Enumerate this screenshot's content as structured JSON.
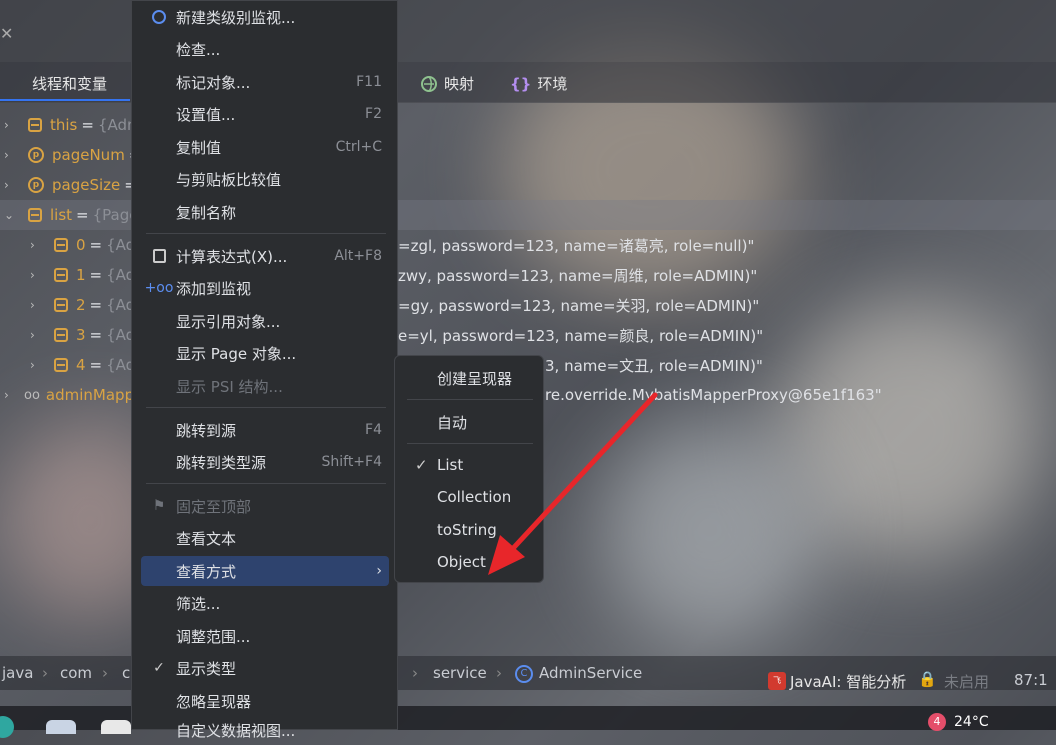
{
  "tabs": {
    "threads_label": "线程和变量",
    "mappings_label": "映射",
    "env_label": "环境"
  },
  "tree": {
    "rows": [
      {
        "name": "this",
        "value": "{Adm",
        "tail": ""
      },
      {
        "name": "pageNum",
        "value": "",
        "tail": ""
      },
      {
        "name": "pageSize",
        "value": "",
        "tail": ""
      },
      {
        "name": "list",
        "value": "{Page",
        "tail": ""
      },
      {
        "name": "0",
        "value": "{Adm",
        "tail": "=zgl, password=123, name=诸葛亮, role=null)\""
      },
      {
        "name": "1",
        "value": "{Adm",
        "tail": "zwy, password=123, name=周维, role=ADMIN)\""
      },
      {
        "name": "2",
        "value": "{Adm",
        "tail": "=gy, password=123, name=关羽, role=ADMIN)\""
      },
      {
        "name": "3",
        "value": "{Adm",
        "tail": "e=yl, password=123, name=颜良, role=ADMIN)\""
      },
      {
        "name": "4",
        "value": "{Adm",
        "tail": "3, name=文丑, role=ADMIN)\""
      },
      {
        "name": "adminMapp",
        "value": "",
        "tail": "re.override.MybatisMapperProxy@65e1f163\""
      }
    ]
  },
  "menu": {
    "items": [
      {
        "label": "新建类级别监视...",
        "shortcut": ""
      },
      {
        "label": "检查...",
        "shortcut": ""
      },
      {
        "label": "标记对象...",
        "shortcut": "F11"
      },
      {
        "label": "设置值...",
        "shortcut": "F2"
      },
      {
        "label": "复制值",
        "shortcut": "Ctrl+C"
      },
      {
        "label": "与剪贴板比较值",
        "shortcut": ""
      },
      {
        "label": "复制名称",
        "shortcut": ""
      },
      {
        "label": "计算表达式(X)...",
        "shortcut": "Alt+F8"
      },
      {
        "label": "添加到监视",
        "shortcut": ""
      },
      {
        "label": "显示引用对象...",
        "shortcut": ""
      },
      {
        "label": "显示 Page 对象...",
        "shortcut": ""
      },
      {
        "label": "显示 PSI 结构...",
        "shortcut": ""
      },
      {
        "label": "跳转到源",
        "shortcut": "F4"
      },
      {
        "label": "跳转到类型源",
        "shortcut": "Shift+F4"
      },
      {
        "label": "固定至顶部",
        "shortcut": ""
      },
      {
        "label": "查看文本",
        "shortcut": ""
      },
      {
        "label": "查看方式",
        "shortcut": ""
      },
      {
        "label": "筛选...",
        "shortcut": ""
      },
      {
        "label": "调整范围...",
        "shortcut": ""
      },
      {
        "label": "显示类型",
        "shortcut": ""
      },
      {
        "label": "忽略呈现器",
        "shortcut": ""
      },
      {
        "label": "自定义数据视图...",
        "shortcut": ""
      }
    ]
  },
  "submenu": {
    "items": [
      "创建呈现器",
      "自动",
      "List",
      "Collection",
      "toString",
      "Object"
    ]
  },
  "breadcrumb": {
    "items": [
      "java",
      "com",
      "c",
      "service",
      "AdminService"
    ]
  },
  "status": {
    "javaai_label": "JavaAI: 智能分析",
    "disabled_label": "未启用",
    "position": "87:1"
  },
  "taskbar": {
    "badge_count": "4",
    "temperature": "24°C"
  },
  "colors": {
    "accent": "#3574f0",
    "highlight": "#2e436e",
    "field": "#d9a343",
    "arrow": "#e8262a"
  }
}
